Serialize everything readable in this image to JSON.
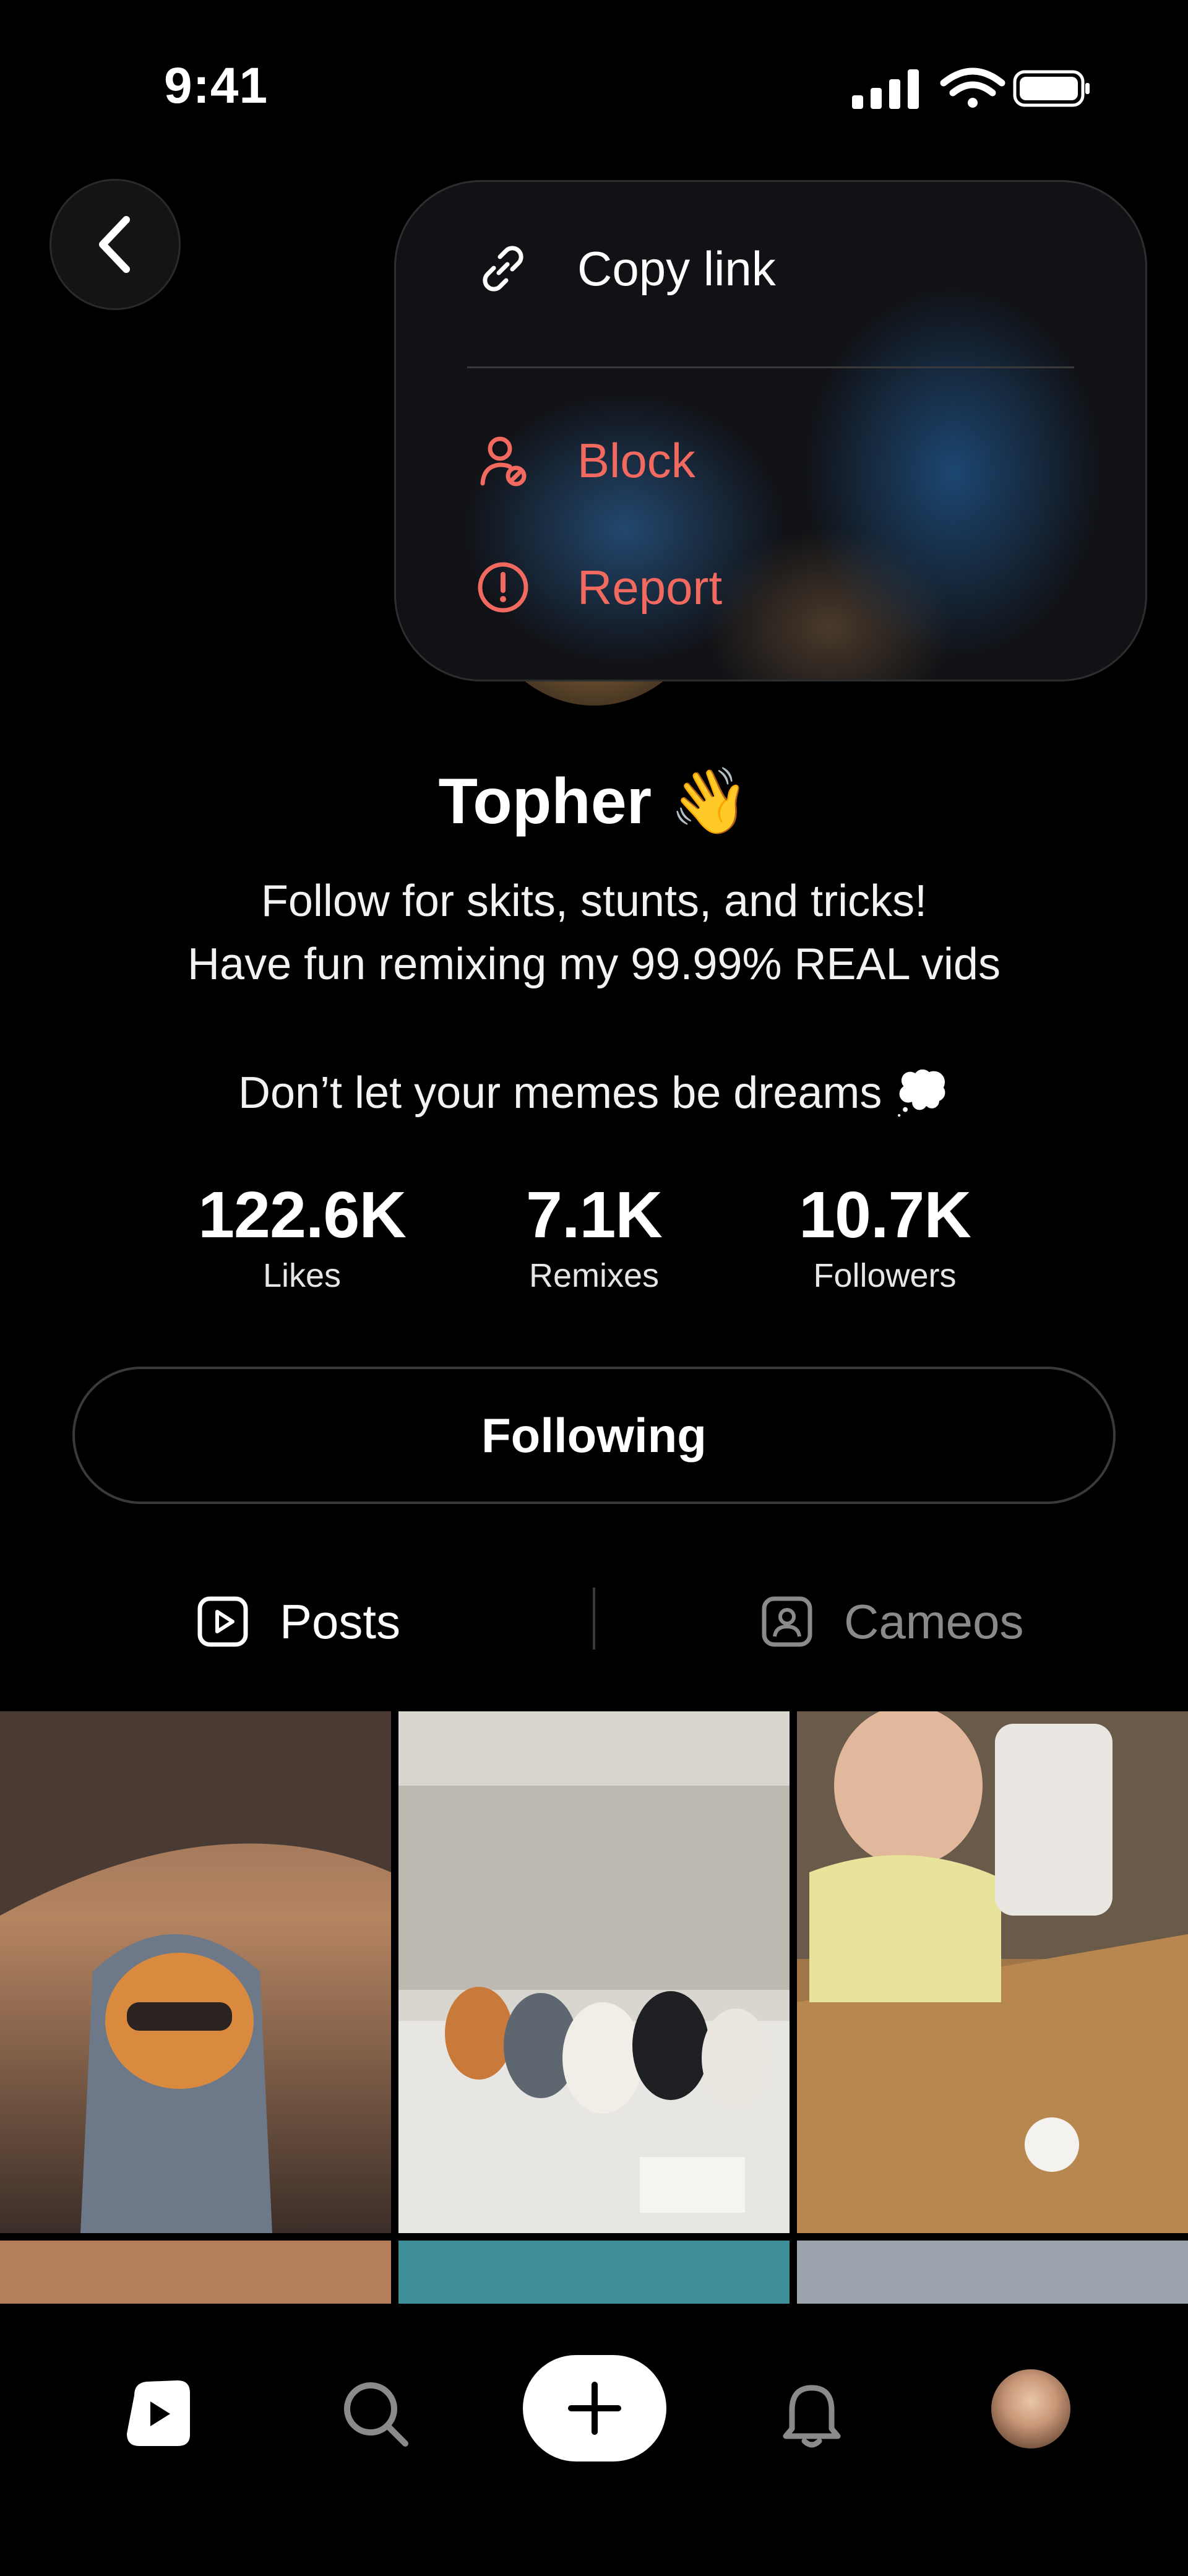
{
  "status_bar": {
    "time": "9:41"
  },
  "menu": {
    "items": [
      {
        "label": "Copy link",
        "icon": "link-icon",
        "color": "#ffffff"
      },
      {
        "label": "Block",
        "icon": "block-user-icon",
        "color": "#f26a5f"
      },
      {
        "label": "Report",
        "icon": "report-icon",
        "color": "#f26a5f"
      }
    ]
  },
  "profile": {
    "name": "Topher",
    "name_emoji": "👋",
    "bio_line1": "Follow for skits, stunts, and tricks!",
    "bio_line2": "Have fun remixing my 99.99% REAL vids",
    "bio_line3": "Don’t let your memes be dreams",
    "bio_line3_emoji": "💭",
    "stats": [
      {
        "value": "122.6K",
        "label": "Likes"
      },
      {
        "value": "7.1K",
        "label": "Remixes"
      },
      {
        "value": "10.7K",
        "label": "Followers"
      }
    ],
    "follow_button": "Following"
  },
  "tabs": [
    {
      "label": "Posts",
      "icon": "play-square-icon",
      "active": true
    },
    {
      "label": "Cameos",
      "icon": "person-square-icon",
      "active": false
    }
  ],
  "colors": {
    "accent_red": "#f26a5f",
    "background": "#000000",
    "inactive_tab": "#8a8a8a"
  },
  "bottom_nav": [
    {
      "name": "home",
      "icon": "play-home-icon"
    },
    {
      "name": "search",
      "icon": "search-icon"
    },
    {
      "name": "create",
      "icon": "plus-icon"
    },
    {
      "name": "notifications",
      "icon": "bell-icon"
    },
    {
      "name": "profile",
      "icon": "avatar"
    }
  ]
}
